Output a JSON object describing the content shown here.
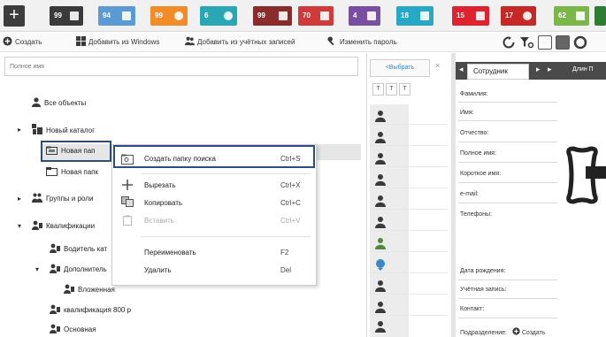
{
  "badges": [
    {
      "label": "99",
      "color": "#3a3a3a"
    },
    {
      "label": "94",
      "color": "#5b9bd5"
    },
    {
      "label": "99",
      "color": "#f28c28"
    },
    {
      "label": "6",
      "color": "#2aa6b5"
    },
    {
      "label": "99",
      "color": "#8b2c2c"
    },
    {
      "label": "70",
      "color": "#d13a3a"
    },
    {
      "label": "4",
      "color": "#7a4fa3"
    },
    {
      "label": "18",
      "color": "#27a8c7"
    },
    {
      "label": "15",
      "color": "#e0212f"
    },
    {
      "label": "17",
      "color": "#c62828"
    },
    {
      "label": "62",
      "color": "#7ab648"
    }
  ],
  "toolbar": {
    "create": "Создать",
    "add_windows": "Добавить из Windows",
    "add_accounts": "Добавить из учётных записей",
    "change_password": "Изменить пароль"
  },
  "search": {
    "placeholder": "Полное имя"
  },
  "tree": {
    "all_objects": "Все объекты",
    "new_catalog": "Новый каталог",
    "new_folder_1": "Новая пап",
    "new_folder_2": "Новая папк",
    "groups_roles": "Группы и роли",
    "qualifications": "Квалификации",
    "drivers": "Водитель кат",
    "additional": "Дополнитель",
    "nested": "Вложенная",
    "qualification_800": "квалификация 800 р",
    "main": "Основная"
  },
  "context_menu": {
    "items": [
      {
        "label": "Создать папку поиска",
        "shortcut": "Ctrl+S",
        "enabled": true
      },
      {
        "label": "Вырезать",
        "shortcut": "Ctrl+X",
        "enabled": true
      },
      {
        "label": "Копировать",
        "shortcut": "Ctrl+C",
        "enabled": true
      },
      {
        "label": "Вставить",
        "shortcut": "Ctrl+V",
        "enabled": false
      },
      {
        "label": "Переименовать",
        "shortcut": "F2",
        "enabled": true
      },
      {
        "label": "Удалить",
        "shortcut": "Del",
        "enabled": true
      }
    ]
  },
  "middle": {
    "tab_label": "<Выбрать",
    "close": "×",
    "filter": "Т"
  },
  "right": {
    "tab_active": "Сотрудник",
    "tab_other": "Длин П",
    "fields": [
      "Фамилия:",
      "Имя:",
      "Отчество:",
      "Полное имя:",
      "Короткое имя:",
      "e-mail:",
      "Телефоны:",
      "Дата рождения:",
      "Учётная запись:",
      "Контакт:",
      "Подразделение:"
    ],
    "create_label": "Создать"
  }
}
